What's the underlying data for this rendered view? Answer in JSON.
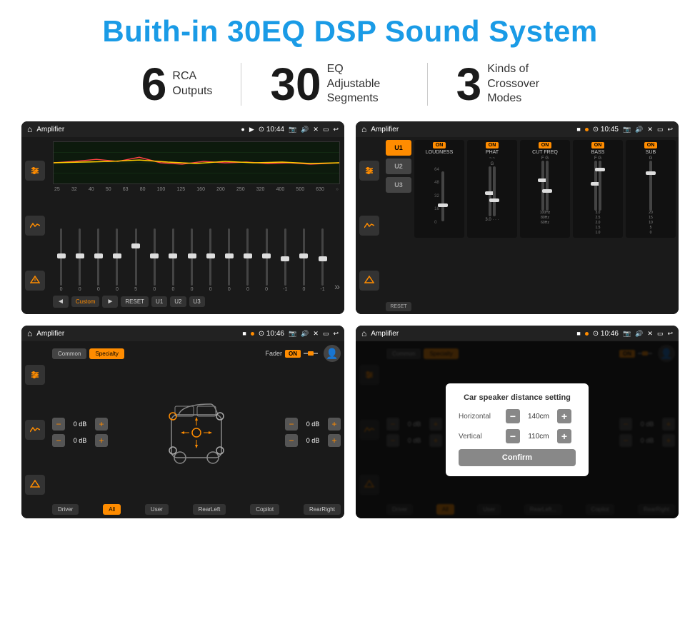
{
  "header": {
    "title": "Buith-in 30EQ DSP Sound System"
  },
  "stats": [
    {
      "number": "6",
      "label": "RCA\nOutputs"
    },
    {
      "number": "30",
      "label": "EQ Adjustable\nSegments"
    },
    {
      "number": "3",
      "label": "Kinds of\nCrossover Modes"
    }
  ],
  "screens": [
    {
      "id": "eq-screen",
      "statusbar": {
        "title": "Amplifier",
        "time": "10:44",
        "indicators": [
          "▶",
          "•"
        ]
      }
    },
    {
      "id": "crossover-screen",
      "statusbar": {
        "title": "Amplifier",
        "time": "10:45",
        "indicators": [
          "■",
          "•"
        ]
      }
    },
    {
      "id": "fader-screen",
      "statusbar": {
        "title": "Amplifier",
        "time": "10:46",
        "indicators": [
          "■",
          "•"
        ]
      }
    },
    {
      "id": "distance-screen",
      "statusbar": {
        "title": "Amplifier",
        "time": "10:46",
        "indicators": [
          "■",
          "•"
        ]
      },
      "modal": {
        "title": "Car speaker distance setting",
        "horizontal_label": "Horizontal",
        "horizontal_value": "140cm",
        "vertical_label": "Vertical",
        "vertical_value": "110cm",
        "confirm_label": "Confirm"
      }
    }
  ],
  "eq": {
    "freq_labels": [
      "25",
      "32",
      "40",
      "50",
      "63",
      "80",
      "100",
      "125",
      "160",
      "200",
      "250",
      "320",
      "400",
      "500",
      "630"
    ],
    "values": [
      "0",
      "0",
      "0",
      "0",
      "5",
      "0",
      "0",
      "0",
      "0",
      "0",
      "0",
      "0",
      "-1",
      "0",
      "-1"
    ],
    "presets": [
      "◄",
      "Custom",
      "►",
      "RESET",
      "U1",
      "U2",
      "U3"
    ]
  },
  "crossover": {
    "presets": [
      "U1",
      "U2",
      "U3"
    ],
    "channels": {
      "loudness": "LOUDNESS",
      "phat": "PHAT",
      "cut_freq": "CUT FREQ",
      "bass": "BASS",
      "sub": "SUB"
    }
  },
  "fader": {
    "tabs": [
      "Common",
      "Specialty"
    ],
    "label": "Fader",
    "on": "ON",
    "volumes": [
      "0 dB",
      "0 dB",
      "0 dB",
      "0 dB"
    ],
    "buttons": [
      "Driver",
      "All",
      "User",
      "RearLeft",
      "Copilot",
      "RearRight"
    ]
  }
}
